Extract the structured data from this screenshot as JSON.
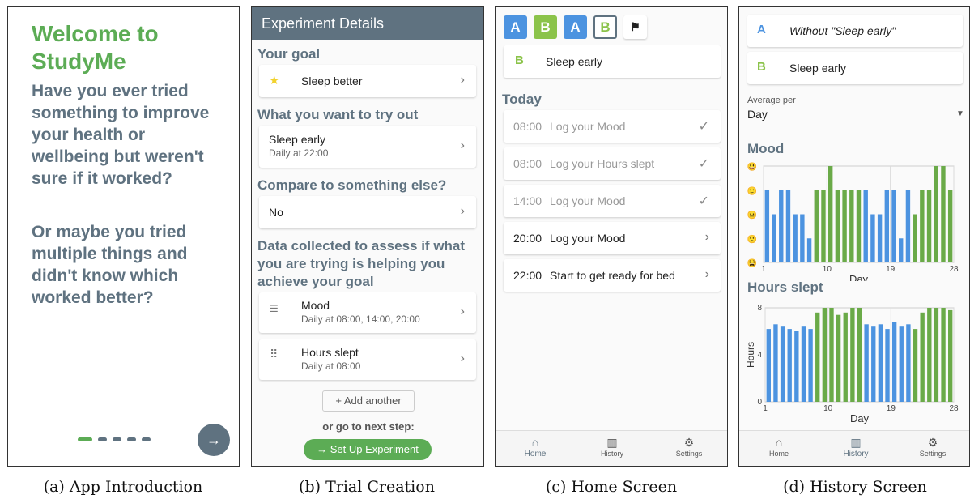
{
  "intro": {
    "title": "Welcome to StudyMe",
    "paragraphs": [
      "Have you ever tried something to improve your health or wellbeing but weren't sure if it worked?",
      "Or maybe you tried multiple things and didn't know which worked better?"
    ],
    "next_icon": "arrow-right-icon",
    "dots_total": 5,
    "dots_active_index": 0,
    "caption": "(a) App Introduction"
  },
  "trial": {
    "app_bar_title": "Experiment Details",
    "goal_heading": "Your goal",
    "goal": {
      "label": "Sleep better",
      "icon": "star-icon"
    },
    "try_heading": "What you want to try out",
    "try": {
      "label": "Sleep early",
      "sub": "Daily at 22:00"
    },
    "compare_heading": "Compare to something else?",
    "compare": {
      "label": "No"
    },
    "data_heading": "Data collected to assess if what you are trying is helping you achieve your goal",
    "measures": [
      {
        "label": "Mood",
        "sub": "Daily at 08:00, 14:00, 20:00",
        "icon": "list-icon"
      },
      {
        "label": "Hours slept",
        "sub": "Daily at 08:00",
        "icon": "keypad-icon"
      }
    ],
    "add_another": "+ Add another",
    "next_step_label": "or go to next step:",
    "setup_button": "→ Set Up Experiment",
    "caption": "(b) Trial Creation"
  },
  "home": {
    "phases": [
      "A",
      "B",
      "A",
      "B"
    ],
    "current_phase_index": 3,
    "current_intervention": {
      "letter": "B",
      "label": "Sleep early"
    },
    "today_heading": "Today",
    "tasks": [
      {
        "time": "08:00",
        "label": "Log your Mood",
        "done": true
      },
      {
        "time": "08:00",
        "label": "Log your Hours slept",
        "done": true
      },
      {
        "time": "14:00",
        "label": "Log your Mood",
        "done": true
      },
      {
        "time": "20:00",
        "label": "Log your Mood",
        "done": false
      },
      {
        "time": "22:00",
        "label": "Start to get ready for bed",
        "done": false
      }
    ],
    "nav": [
      {
        "label": "Home",
        "icon": "home-icon",
        "active": true
      },
      {
        "label": "History",
        "icon": "chart-icon",
        "active": false
      },
      {
        "label": "Settings",
        "icon": "gear-icon",
        "active": false
      }
    ],
    "caption": "(c) Home Screen"
  },
  "history": {
    "interventions": [
      {
        "letter": "A",
        "label": "Without \"Sleep early\""
      },
      {
        "letter": "B",
        "label": "Sleep early"
      }
    ],
    "average_label": "Average per",
    "average_value": "Day",
    "nav": [
      {
        "label": "Home",
        "icon": "home-icon",
        "active": false
      },
      {
        "label": "History",
        "icon": "chart-icon",
        "active": true
      },
      {
        "label": "Settings",
        "icon": "gear-icon",
        "active": false
      }
    ],
    "caption": "(d) History Screen"
  },
  "colors": {
    "green": "#5cac55",
    "slate": "#5f7280",
    "blue": "#4c93e0",
    "bar_green": "#6aaa48"
  },
  "chart_data": [
    {
      "type": "bar",
      "title": "Mood",
      "xlabel": "Day",
      "ylabel": "",
      "y_levels": [
        "very-sad-face-icon",
        "sad-face-icon",
        "neutral-face-icon",
        "happy-face-icon",
        "very-happy-face-icon"
      ],
      "ylim": [
        0,
        4
      ],
      "x_ticks": [
        "1",
        "10",
        "19",
        "28"
      ],
      "categories": [
        1,
        2,
        3,
        4,
        5,
        6,
        7,
        8,
        9,
        10,
        11,
        12,
        13,
        14,
        15,
        16,
        17,
        18,
        19,
        20,
        21,
        22,
        23,
        24,
        25,
        26,
        27
      ],
      "phase": [
        "A",
        "A",
        "A",
        "A",
        "A",
        "A",
        "A",
        "B",
        "B",
        "B",
        "B",
        "B",
        "B",
        "B",
        "A",
        "A",
        "A",
        "A",
        "A",
        "A",
        "A",
        "B",
        "B",
        "B",
        "B",
        "B",
        "B"
      ],
      "values": [
        3,
        2,
        3,
        3,
        2,
        2,
        1,
        3,
        3,
        4,
        3,
        3,
        3,
        3,
        3,
        2,
        2,
        3,
        3,
        1,
        3,
        2,
        3,
        3,
        4,
        4,
        3
      ]
    },
    {
      "type": "bar",
      "title": "Hours slept",
      "xlabel": "Day",
      "ylabel": "Hours",
      "y_ticks": [
        "0",
        "4",
        "8"
      ],
      "ylim": [
        0,
        8
      ],
      "x_ticks": [
        "1",
        "10",
        "19",
        "28"
      ],
      "categories": [
        1,
        2,
        3,
        4,
        5,
        6,
        7,
        8,
        9,
        10,
        11,
        12,
        13,
        14,
        15,
        16,
        17,
        18,
        19,
        20,
        21,
        22,
        23,
        24,
        25,
        26,
        27
      ],
      "phase": [
        "A",
        "A",
        "A",
        "A",
        "A",
        "A",
        "A",
        "B",
        "B",
        "B",
        "B",
        "B",
        "B",
        "B",
        "A",
        "A",
        "A",
        "A",
        "A",
        "A",
        "A",
        "B",
        "B",
        "B",
        "B",
        "B",
        "B"
      ],
      "values": [
        6.2,
        6.6,
        6.4,
        6.2,
        6,
        6.4,
        6.2,
        7.6,
        8,
        8,
        7.4,
        7.6,
        8,
        8,
        6.6,
        6.4,
        6.6,
        6.2,
        6.8,
        6.4,
        6.6,
        6.2,
        7.6,
        8,
        8,
        8,
        7.8
      ]
    }
  ]
}
